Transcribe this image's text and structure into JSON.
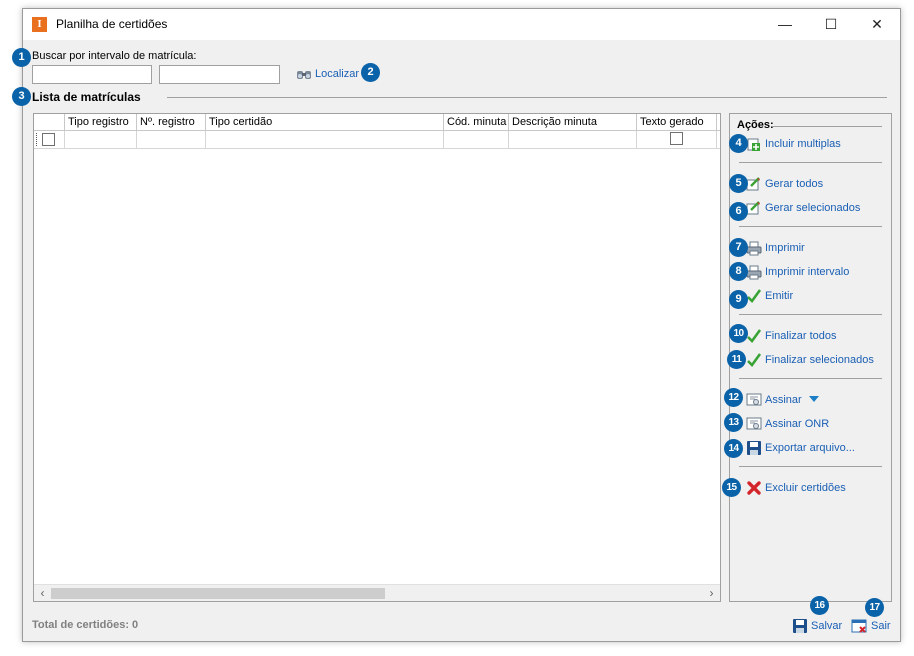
{
  "window": {
    "title": "Planilha de certidões",
    "app_icon_letter": "I",
    "minimize_glyph": "—",
    "maximize_glyph": "☐",
    "close_glyph": "✕"
  },
  "search": {
    "label": "Buscar por intervalo de matrícula:",
    "from_value": "",
    "to_value": "",
    "button_label": "Localizar"
  },
  "list": {
    "section_title": "Lista de matrículas",
    "columns": [
      "Tipo registro",
      "Nº. registro",
      "Tipo certidão",
      "Cód. minuta",
      "Descrição minuta",
      "Texto gerado"
    ],
    "rows": [
      {
        "tipo_registro": "",
        "n_registro": "",
        "tipo_certidao": "",
        "cod_minuta": "",
        "descricao_minuta": "",
        "texto_gerado": false
      }
    ]
  },
  "actions": {
    "title": "Ações:",
    "items": [
      {
        "label": "Incluir multiplas",
        "icon": "add-multiple-icon",
        "badge": "4"
      },
      {
        "label": "Gerar todos",
        "icon": "generate-icon",
        "badge": "5"
      },
      {
        "label": "Gerar selecionados",
        "icon": "generate-selected-icon",
        "badge": "6"
      },
      {
        "label": "Imprimir",
        "icon": "printer-icon",
        "badge": "7"
      },
      {
        "label": "Imprimir intervalo",
        "icon": "print-range-icon",
        "badge": "8"
      },
      {
        "label": "Emitir",
        "icon": "checkmark-icon",
        "badge": "9"
      },
      {
        "label": "Finalizar todos",
        "icon": "checkmark-icon",
        "badge": "10"
      },
      {
        "label": "Finalizar selecionados",
        "icon": "checkmark-icon",
        "badge": "11"
      },
      {
        "label": "Assinar",
        "icon": "certificate-icon",
        "badge": "12"
      },
      {
        "label": "Assinar ONR",
        "icon": "certificate-icon",
        "badge": "13"
      },
      {
        "label": "Exportar arquivo...",
        "icon": "floppy-disk-icon",
        "badge": "14"
      },
      {
        "label": "Excluir certidões",
        "icon": "red-x-icon",
        "badge": "15"
      }
    ]
  },
  "footer": {
    "status_text": "Total de certidões: 0",
    "save_label": "Salvar",
    "exit_label": "Sair"
  },
  "badges": {
    "b1": "1",
    "b2": "2",
    "b3": "3",
    "b16": "16",
    "b17": "17"
  },
  "colors": {
    "badge": "#0a62a8",
    "link": "#1a5fb4",
    "app_icon": "#e8701f",
    "window_bg": "#f0f0f0"
  }
}
